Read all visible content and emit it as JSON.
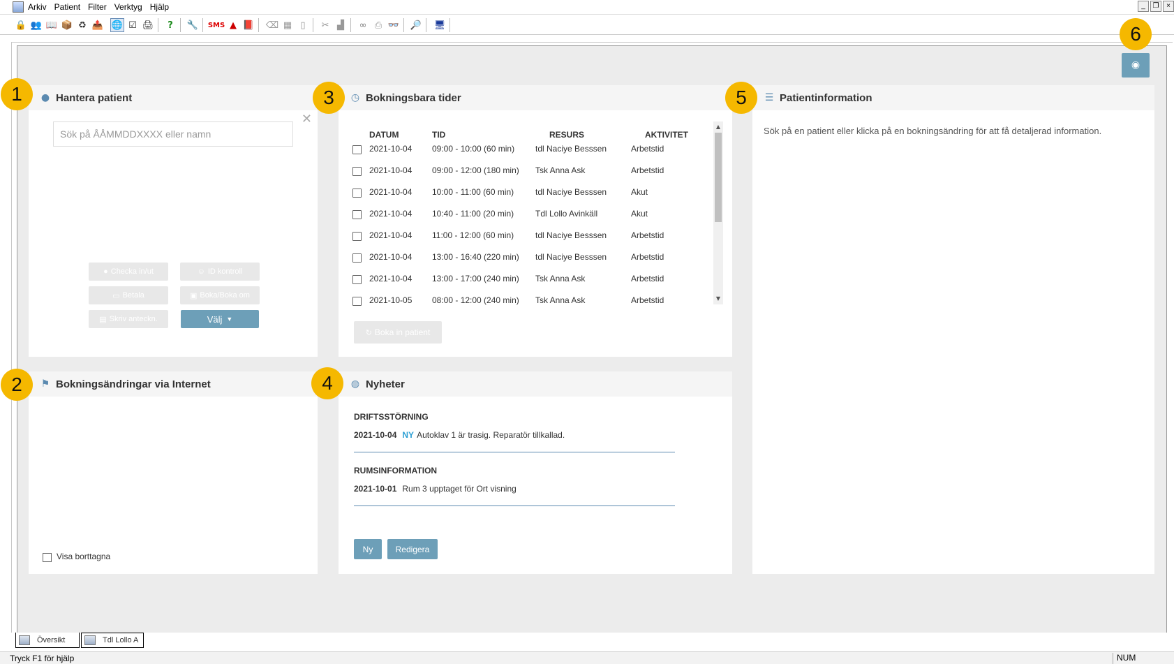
{
  "menu": [
    "Arkiv",
    "Patient",
    "Filter",
    "Verktyg",
    "Hjälp"
  ],
  "window_controls": [
    "_",
    "❐",
    "×"
  ],
  "toolbar_icons": [
    "lock-icon",
    "patients-icon",
    "calendar-icon",
    "package-icon",
    "refresh-icon",
    "export-icon",
    "person-globe-icon",
    "checklist-icon",
    "print-user-icon",
    "help-icon",
    "tools-icon",
    "sms-icon",
    "pdf-icon",
    "book-icon",
    "eraser-icon",
    "grid-icon",
    "book-open-icon",
    "scissors-icon",
    "paste-icon",
    "binoculars-icon",
    "printer-icon",
    "glasses-icon",
    "magnifier-icon",
    "monitor-icon"
  ],
  "badges": [
    "1",
    "2",
    "3",
    "4",
    "5",
    "6"
  ],
  "hantera": {
    "title": "Hantera patient",
    "search_placeholder": "Sök på ÅÅMMDDXXXX eller namn",
    "close": "✕",
    "buttons": {
      "checka": "Checka in/ut",
      "id_kontroll": "ID kontroll",
      "betala": "Betala",
      "boka": "Boka/Boka om",
      "skriv": "Skriv anteckn.",
      "valj": "Välj"
    }
  },
  "bokningsbara": {
    "title": "Bokningsbara tider",
    "columns": [
      "DATUM",
      "TID",
      "RESURS",
      "AKTIVITET"
    ],
    "rows": [
      [
        "2021-10-04",
        "09:00 - 10:00  (60 min)",
        "tdl Naciye Besssen",
        "Arbetstid"
      ],
      [
        "2021-10-04",
        "09:00 - 12:00  (180 min)",
        "Tsk Anna Ask",
        "Arbetstid"
      ],
      [
        "2021-10-04",
        "10:00 - 11:00  (60 min)",
        "tdl Naciye Besssen",
        "Akut"
      ],
      [
        "2021-10-04",
        "10:40 - 11:00  (20 min)",
        "Tdl Lollo Avinkäll",
        "Akut"
      ],
      [
        "2021-10-04",
        "11:00 - 12:00  (60 min)",
        "tdl Naciye Besssen",
        "Arbetstid"
      ],
      [
        "2021-10-04",
        "13:00 - 16:40  (220 min)",
        "tdl Naciye Besssen",
        "Arbetstid"
      ],
      [
        "2021-10-04",
        "13:00 - 17:00  (240 min)",
        "Tsk Anna Ask",
        "Arbetstid"
      ],
      [
        "2021-10-05",
        "08:00 - 12:00  (240 min)",
        "Tsk Anna Ask",
        "Arbetstid"
      ]
    ],
    "boka_in": "Boka in patient"
  },
  "patientinfo": {
    "title": "Patientinformation",
    "text": "Sök på en patient eller klicka på en bokningsändring för att få detaljerad information."
  },
  "bokningsandringar": {
    "title": "Bokningsändringar via Internet",
    "visa_borttagna": "Visa borttagna"
  },
  "nyheter": {
    "title": "Nyheter",
    "items": [
      {
        "category": "DRIFTSSTÖRNING",
        "date": "2021-10-04",
        "tag": "NY",
        "text": "Autoklav 1 är trasig. Reparatör tillkallad."
      },
      {
        "category": "RUMSINFORMATION",
        "date": "2021-10-01",
        "tag": "",
        "text": "Rum 3 upptaget för Ort visning"
      }
    ],
    "ny_button": "Ny",
    "redigera_button": "Redigera"
  },
  "tabs": [
    "Översikt",
    "Tdl Lollo A"
  ],
  "status": {
    "help": "Tryck F1 för hjälp",
    "num": "NUM"
  }
}
